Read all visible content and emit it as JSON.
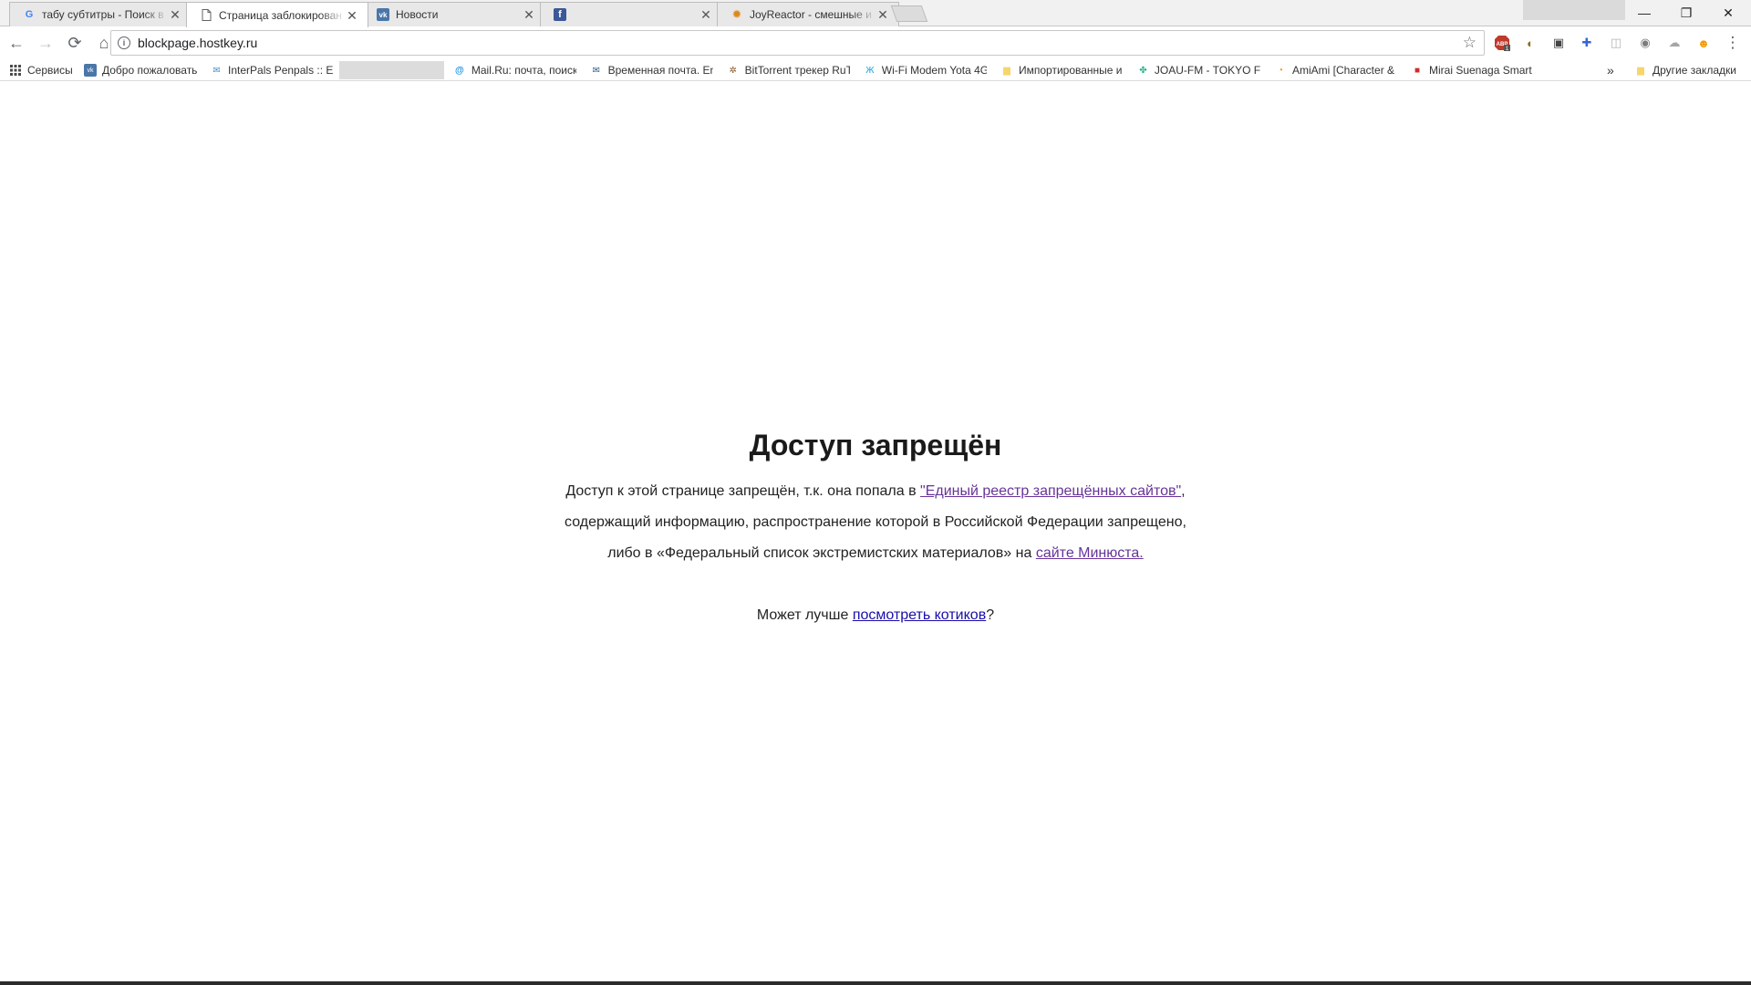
{
  "tabs": [
    {
      "title": "табу субтитры - Поиск в",
      "icon": "google-icon",
      "icon_glyph": "G",
      "icon_color": "#4285f4"
    },
    {
      "title": "Страница заблокирован",
      "icon": "document-icon",
      "icon_glyph": "🗋",
      "icon_color": "#5f6368"
    },
    {
      "title": "Новости",
      "icon": "vk-icon",
      "icon_glyph": "vk",
      "icon_color": "#4a76a8"
    },
    {
      "title": "",
      "icon": "facebook-icon",
      "icon_glyph": "f",
      "icon_color": "#3b5998"
    },
    {
      "title": "JoyReactor - смешные и",
      "icon": "joyreactor-icon",
      "icon_glyph": "✹",
      "icon_color": "#d98a1f"
    }
  ],
  "tab_close_glyph": "✕",
  "window_controls": {
    "minimize": "—",
    "restore": "❐",
    "close": "✕"
  },
  "toolbar": {
    "back": "←",
    "forward": "→",
    "reload": "⟳",
    "home": "⌂",
    "url": "blockpage.hostkey.ru",
    "star": "☆",
    "menu": "⋮"
  },
  "extensions": [
    {
      "name": "adblock-icon",
      "glyph": "ABP",
      "color": "#c0392b"
    },
    {
      "name": "shield-icon",
      "glyph": "◐",
      "color": "#8a6d1d"
    },
    {
      "name": "screenshot-icon",
      "glyph": "▣",
      "color": "#444444"
    },
    {
      "name": "puzzle-icon",
      "glyph": "✚",
      "color": "#3367d6"
    },
    {
      "name": "camera-icon",
      "glyph": "◫",
      "color": "#b5b5b5"
    },
    {
      "name": "eye-icon",
      "glyph": "◉",
      "color": "#7d7d7d"
    },
    {
      "name": "cloud-icon",
      "glyph": "☁",
      "color": "#a5a5a5"
    },
    {
      "name": "hola-icon",
      "glyph": "☻",
      "color": "#f29b05"
    }
  ],
  "bookmarks": [
    {
      "label": "Сервисы",
      "icon": "apps-icon",
      "glyph": "⋮⋮",
      "color": "#4285f4"
    },
    {
      "label": "Добро пожаловать",
      "icon": "vk-icon",
      "glyph": "vk",
      "color": "#4a76a8"
    },
    {
      "label": "InterPals Penpals :: El_",
      "icon": "mail-icon",
      "glyph": "✉",
      "color": "#4a90c8"
    },
    {
      "label": "Mail.Ru: почта, поиск",
      "icon": "mailru-icon",
      "glyph": "@",
      "color": "#168de2"
    },
    {
      "label": "Временная почта. En",
      "icon": "tempmail-icon",
      "glyph": "✉",
      "color": "#2a5d8f"
    },
    {
      "label": "BitTorrent трекер RuT",
      "icon": "rutracker-icon",
      "glyph": "✲",
      "color": "#8a5a2b"
    },
    {
      "label": "Wi-Fi Modem Yota 4G",
      "icon": "yota-icon",
      "glyph": "Ж",
      "color": "#1a9fd9"
    },
    {
      "label": "Импортированные и",
      "icon": "folder-icon",
      "glyph": "▆",
      "color": "#f6d56b"
    },
    {
      "label": "JOAU-FM - TOKYO FM",
      "icon": "joau-icon",
      "glyph": "✤",
      "color": "#2db58f"
    },
    {
      "label": "AmiAmi [Character &",
      "icon": "amiami-icon",
      "glyph": "◔",
      "color": "#f08a1c"
    },
    {
      "label": "Mirai Suenaga Smart",
      "icon": "mirai-icon",
      "glyph": "■",
      "color": "#d42a2a"
    }
  ],
  "bookmarks_overflow": "»",
  "other_bookmarks": {
    "label": "Другие закладки",
    "icon": "folder-icon",
    "glyph": "▆",
    "color": "#f6d56b"
  },
  "page": {
    "heading": "Доступ запрещён",
    "line1_prefix": "Доступ к этой странице запрещён, т.к. она попала в ",
    "line1_link": "\"Единый реестр запрещённых сайтов\"",
    "line1_suffix": ",",
    "line2": "содержащий информацию, распространение которой в Российской Федерации запрещено,",
    "line3_prefix": "либо в «Федеральный список экстремистских материалов» на ",
    "line3_link": "сайте Минюста.",
    "line4_prefix": "Может лучше ",
    "line4_link": "посмотреть котиков",
    "line4_suffix": "?"
  }
}
